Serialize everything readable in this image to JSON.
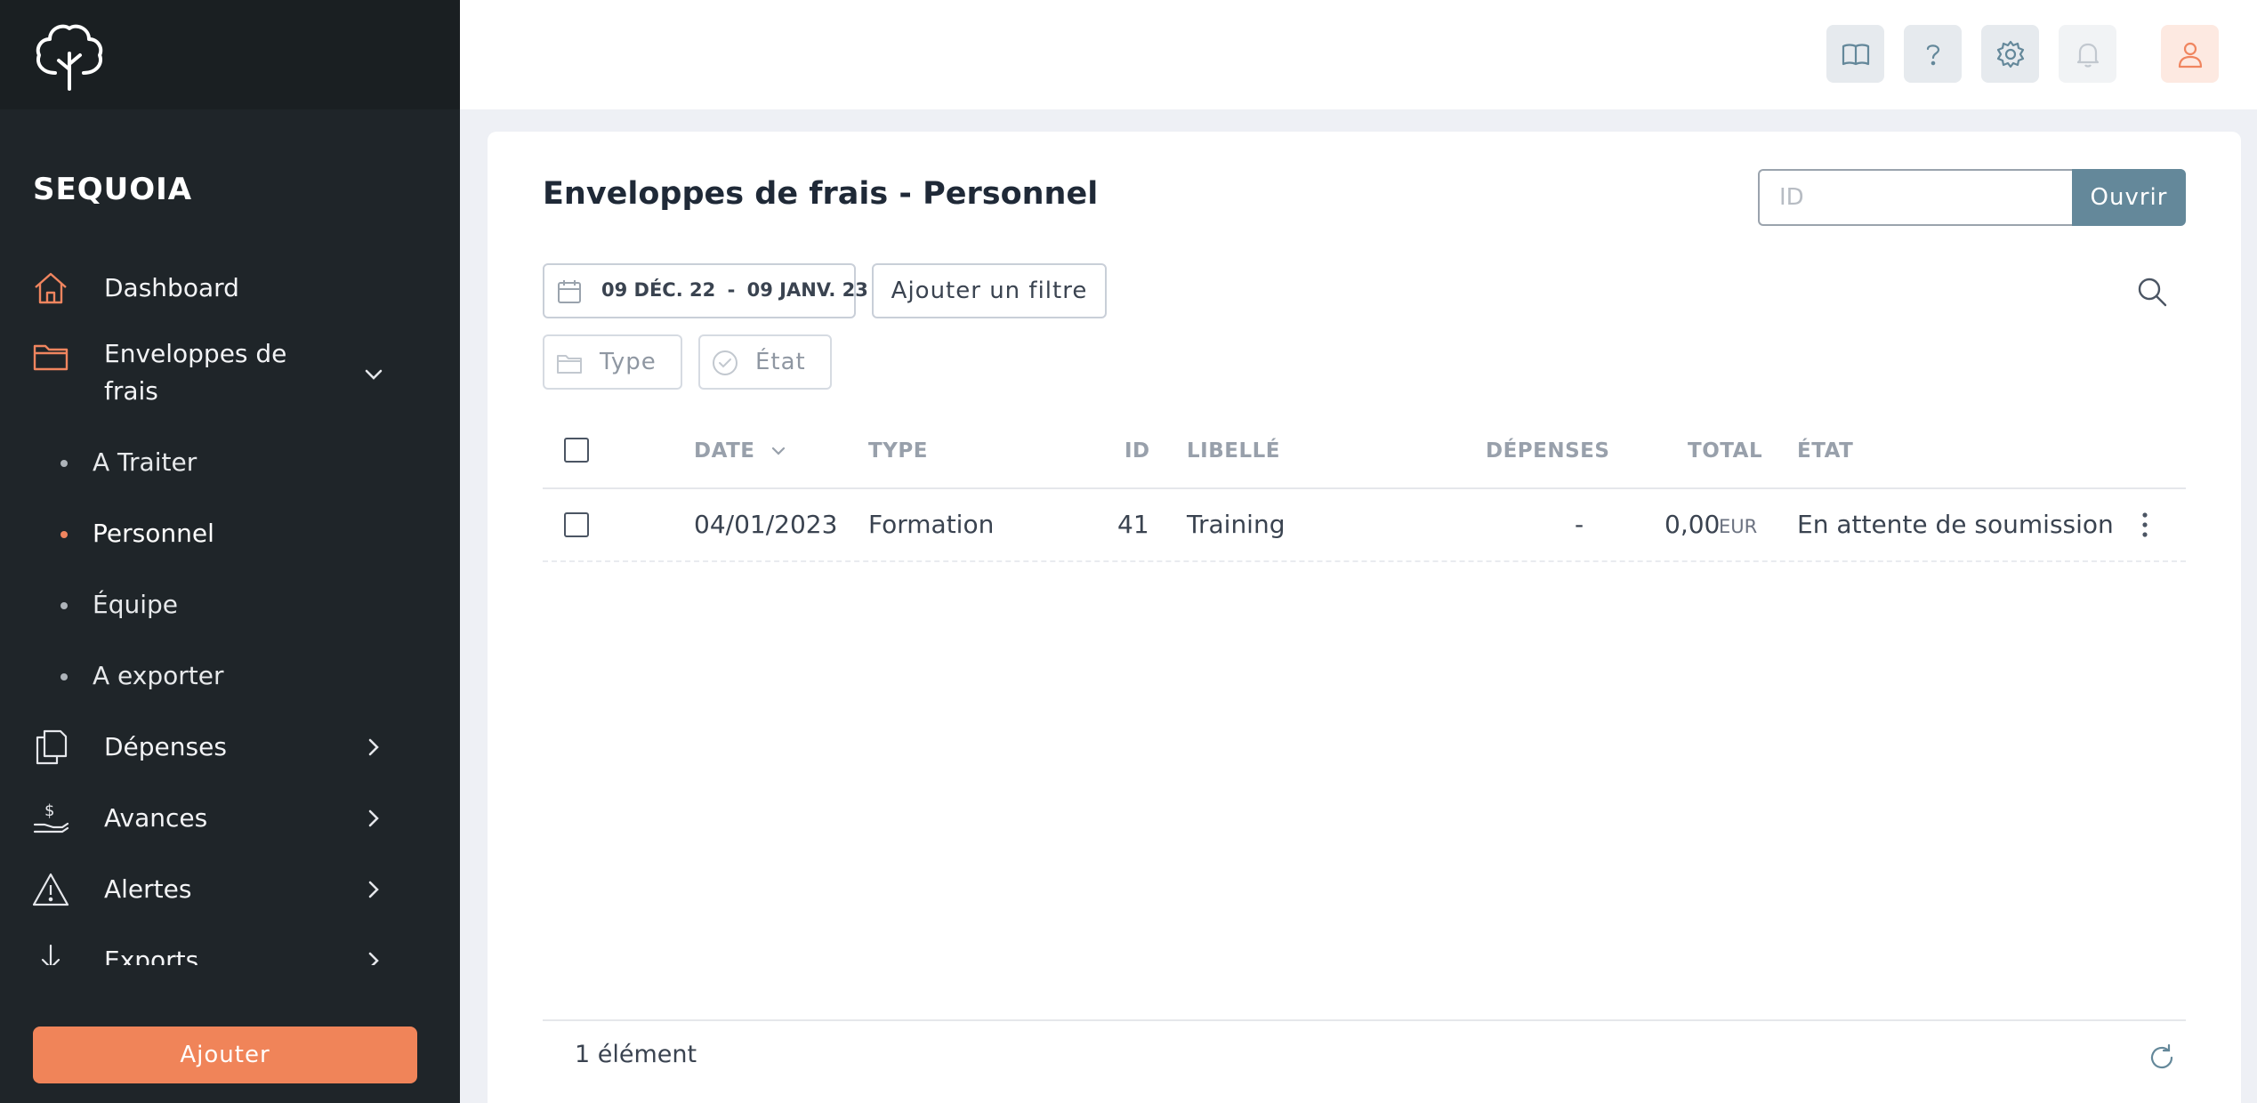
{
  "sidebar": {
    "brand": "SEQUOIA",
    "nav": [
      {
        "label": "Dashboard",
        "icon": "home-icon"
      },
      {
        "label": "Enveloppes de\nfrais",
        "icon": "folder-icon",
        "expanded": true
      },
      {
        "label": "Dépenses",
        "icon": "documents-icon"
      },
      {
        "label": "Avances",
        "icon": "hand-money-icon"
      },
      {
        "label": "Alertes",
        "icon": "warning-icon"
      },
      {
        "label": "Exports",
        "icon": "download-icon"
      }
    ],
    "sub_items": [
      {
        "label": "A Traiter",
        "active": false
      },
      {
        "label": "Personnel",
        "active": true
      },
      {
        "label": "Équipe",
        "active": false
      },
      {
        "label": "A exporter",
        "active": false
      }
    ],
    "add_button": "Ajouter",
    "accent_color": "#f08459"
  },
  "header": {
    "buttons": [
      "book-icon",
      "help-icon",
      "settings-icon",
      "bell-icon",
      "user-icon"
    ]
  },
  "main": {
    "title": "Enveloppes de frais - Personnel",
    "id_search": {
      "placeholder": "ID",
      "button": "Ouvrir"
    },
    "date_filter": {
      "from": "09 DÉC. 22",
      "separator": "-",
      "to": "09 JANV. 23"
    },
    "add_filter": "Ajouter un filtre",
    "chips": [
      {
        "label": "Type",
        "icon": "folder-icon"
      },
      {
        "label": "État",
        "icon": "check-circle-icon"
      }
    ],
    "table": {
      "columns": [
        "DATE",
        "TYPE",
        "ID",
        "LIBELLÉ",
        "DÉPENSES",
        "TOTAL",
        "ÉTAT"
      ],
      "rows": [
        {
          "date": "04/01/2023",
          "type": "Formation",
          "id": "41",
          "libelle": "Training",
          "depenses": "-",
          "total": "0,00",
          "currency": "EUR",
          "etat": "En attente de soumission"
        }
      ]
    },
    "count": "1 élément"
  }
}
